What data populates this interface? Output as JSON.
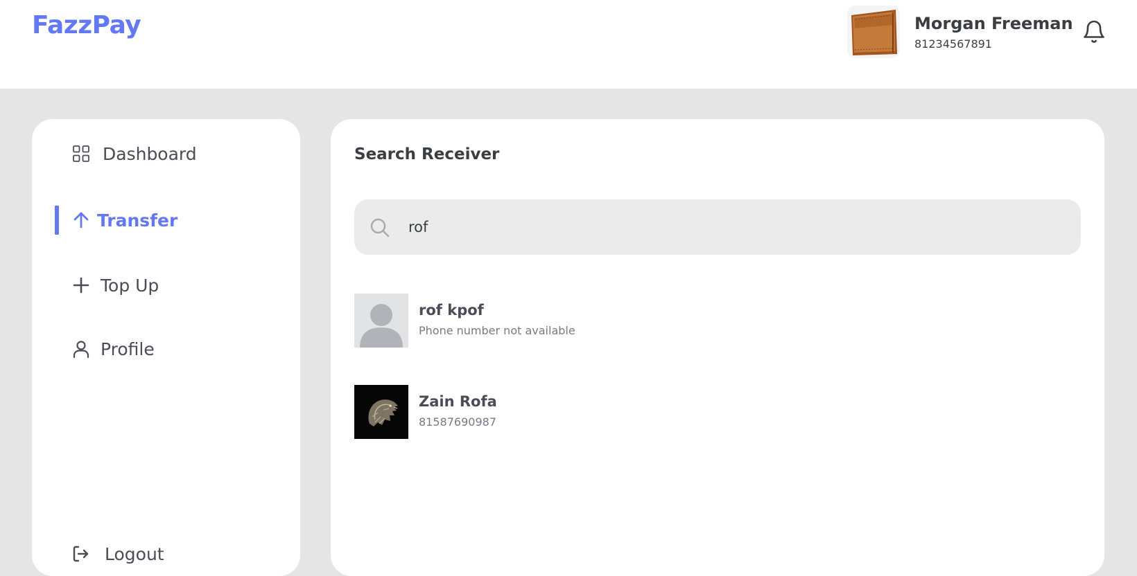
{
  "brand": {
    "name": "FazzPay",
    "accent": "#6379f4"
  },
  "user": {
    "name": "Morgan Freeman",
    "phone": "81234567891",
    "avatar_icon": "wallet-image"
  },
  "notifications": {
    "icon": "bell-icon"
  },
  "sidebar": {
    "items": [
      {
        "label": "Dashboard",
        "icon": "grid-icon",
        "active": false
      },
      {
        "label": "Transfer",
        "icon": "arrow-up-icon",
        "active": true
      },
      {
        "label": "Top Up",
        "icon": "plus-icon",
        "active": false
      },
      {
        "label": "Profile",
        "icon": "user-icon",
        "active": false
      }
    ],
    "logout": {
      "label": "Logout",
      "icon": "logout-icon"
    }
  },
  "main": {
    "title": "Search Receiver",
    "search": {
      "value": "rof",
      "placeholder": ""
    },
    "results": [
      {
        "name": "rof kpof",
        "phone": "Phone number not available",
        "avatar": "default-avatar"
      },
      {
        "name": "Zain Rofa",
        "phone": "81587690987",
        "avatar": "wolf-sigil-image"
      }
    ]
  }
}
